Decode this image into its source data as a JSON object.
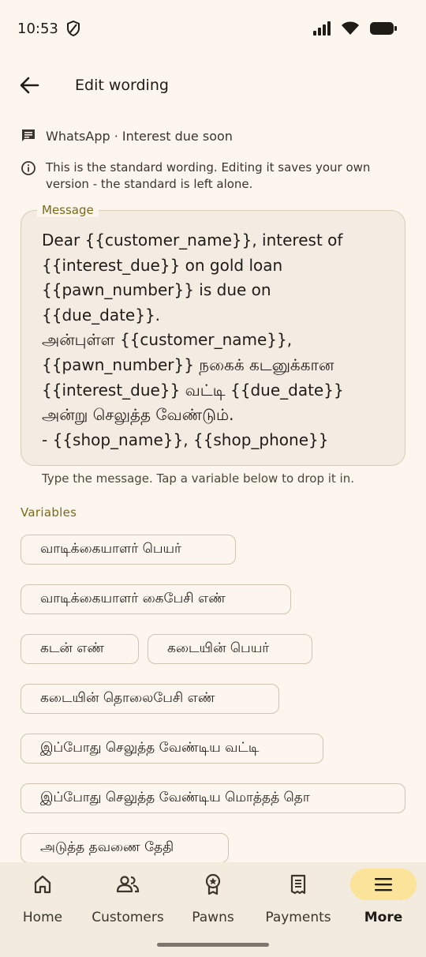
{
  "status_bar": {
    "time": "10:53"
  },
  "app_bar": {
    "title": "Edit wording"
  },
  "channel": {
    "text": "WhatsApp · Interest due soon"
  },
  "info": {
    "text": "This is the standard wording. Editing it saves your own version - the standard is left alone."
  },
  "message": {
    "label": "Message",
    "text": "Dear {{customer_name}}, interest of\n{{interest_due}} on gold loan\n{{pawn_number}} is due on\n{{due_date}}.\nஅன்புள்ள {{customer_name}},\n{{pawn_number}} நகைக் கடனுக்கான\n{{interest_due}} வட்டி {{due_date}}\nஅன்று செலுத்த வேண்டும்.\n- {{shop_name}}, {{shop_phone}}",
    "helper": "Type the message. Tap a variable below to drop it in."
  },
  "variables": {
    "title": "Variables",
    "chips": [
      "வாடிக்கையாளர் பெயர்",
      "வாடிக்கையாளர் கைபேசி எண்",
      "கடன் எண்",
      "கடையின் பெயர்",
      "கடையின் தொலைபேசி எண்",
      "இப்போது செலுத்த வேண்டிய வட்டி",
      "இப்போது செலுத்த வேண்டிய மொத்தத் தொ",
      "அடுத்த தவணை தேதி"
    ]
  },
  "bottom_nav": {
    "items": [
      {
        "label": "Home",
        "icon": "home-icon",
        "active": false
      },
      {
        "label": "Customers",
        "icon": "people-icon",
        "active": false
      },
      {
        "label": "Pawns",
        "icon": "badge-icon",
        "active": false
      },
      {
        "label": "Payments",
        "icon": "receipt-icon",
        "active": false
      },
      {
        "label": "More",
        "icon": "menu-icon",
        "active": true
      }
    ]
  },
  "colors": {
    "background": "#fdf6ee",
    "accent": "#7a6a14",
    "active_nav": "#fbe39a",
    "field": "#f3ece2"
  }
}
